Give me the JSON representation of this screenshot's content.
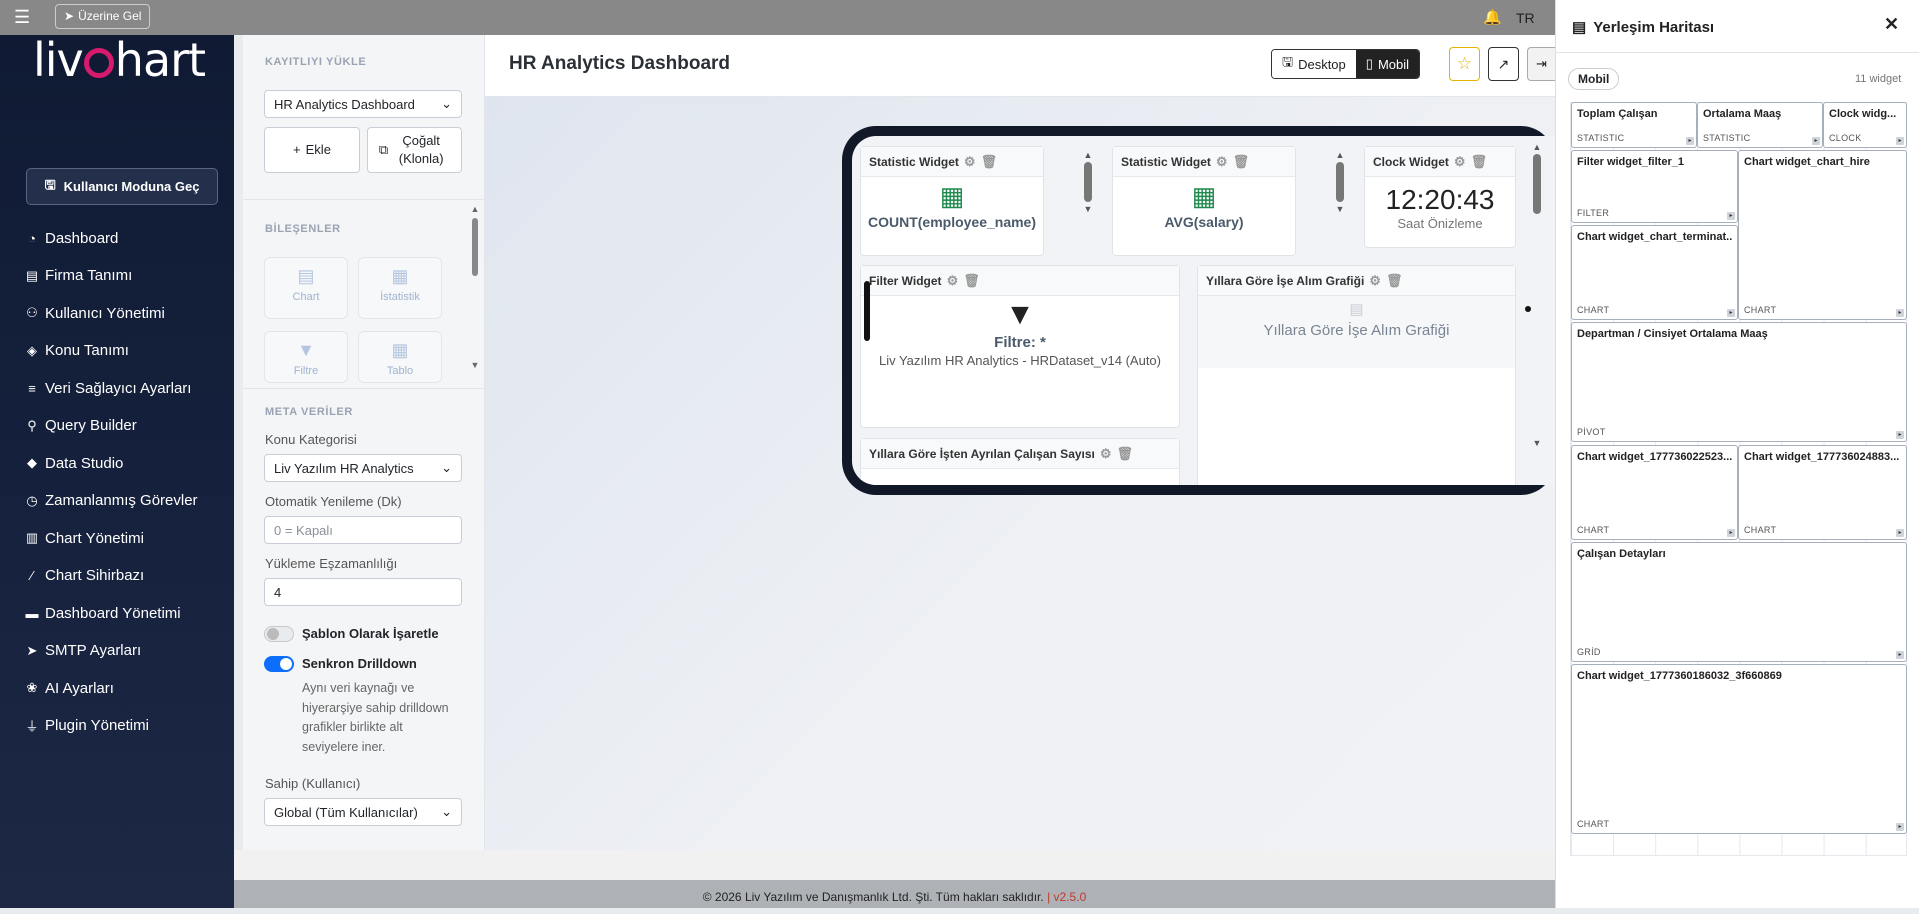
{
  "topbar": {
    "hover_label": "Üzerine Gel",
    "lang": "TR"
  },
  "brand": {
    "logo_left": "liv",
    "logo_right": "hart"
  },
  "nav": {
    "user_mode_button": "Kullanıcı Moduna Geç",
    "items": [
      {
        "label": "Dashboard",
        "icon": "gauge-icon"
      },
      {
        "label": "Firma Tanımı",
        "icon": "building-icon"
      },
      {
        "label": "Kullanıcı Yönetimi",
        "icon": "users-icon"
      },
      {
        "label": "Konu Tanımı",
        "icon": "tag-icon"
      },
      {
        "label": "Veri Sağlayıcı Ayarları",
        "icon": "server-icon"
      },
      {
        "label": "Query Builder",
        "icon": "search-icon"
      },
      {
        "label": "Data Studio",
        "icon": "layers-icon"
      },
      {
        "label": "Zamanlanmış Görevler",
        "icon": "clock-icon"
      },
      {
        "label": "Chart Yönetimi",
        "icon": "chart-icon"
      },
      {
        "label": "Chart Sihirbazı",
        "icon": "wand-icon"
      },
      {
        "label": "Dashboard Yönetimi",
        "icon": "card-icon"
      },
      {
        "label": "SMTP Ayarları",
        "icon": "send-icon"
      },
      {
        "label": "AI Ayarları",
        "icon": "brain-icon"
      },
      {
        "label": "Plugin Yönetimi",
        "icon": "plug-icon"
      }
    ]
  },
  "left_panel": {
    "load_title": "KAYITLIYI YÜKLE",
    "dashboard_select": "HR Analytics Dashboard",
    "add_button": "Ekle",
    "clone_button": "Çoğalt (Klonla)",
    "components_title": "BİLEŞENLER",
    "components": [
      {
        "label": "Chart",
        "icon": "chart-icon"
      },
      {
        "label": "İstatistik",
        "icon": "calculator-icon"
      },
      {
        "label": "Filtre",
        "icon": "filter-icon"
      },
      {
        "label": "Tablo",
        "icon": "table-icon"
      }
    ],
    "meta_title": "META VERİLER",
    "category_label": "Konu Kategorisi",
    "category_value": "Liv Yazılım HR Analytics",
    "refresh_label": "Otomatik Yenileme (Dk)",
    "refresh_placeholder": "0 = Kapalı",
    "concurrency_label": "Yükleme Eşzamanlılığı",
    "concurrency_value": "4",
    "template_toggle_label": "Şablon Olarak İşaretle",
    "template_toggle_on": false,
    "sync_toggle_label": "Senkron Drilldown",
    "sync_toggle_on": true,
    "sync_desc": "Aynı veri kaynağı ve hiyerarşiye sahip drilldown grafikler birlikte alt seviyelere iner.",
    "owner_label": "Sahip (Kullanıcı)",
    "owner_value": "Global (Tüm Kullanıcılar)"
  },
  "header": {
    "title": "HR Analytics Dashboard",
    "view_desktop": "Desktop",
    "view_mobile": "Mobil",
    "active_view": "Mobil"
  },
  "preview": {
    "stat1": {
      "title": "Statistic Widget",
      "value": "COUNT(employee_name)"
    },
    "stat2": {
      "title": "Statistic Widget",
      "value": "AVG(salary)"
    },
    "clock": {
      "title": "Clock Widget",
      "time": "12:20:43",
      "caption": "Saat Önizleme"
    },
    "filter": {
      "title": "Filter Widget",
      "text": "Filtre: *",
      "source": "Liv Yazılım HR Analytics - HRDataset_v14 (Auto)"
    },
    "hire_chart": {
      "title": "Yıllara Göre İşe Alım Grafiği",
      "body": "Yıllara Göre İşe Alım Grafiği"
    },
    "term_chart": {
      "title": "Yıllara Göre İşten Ayrılan Çalışan Sayısı"
    }
  },
  "footer": {
    "text": "© 2026 Liv Yazılım ve Danışmanlık Ltd. Şti. Tüm hakları saklıdır.",
    "sep": "|",
    "version": "v2.5.0"
  },
  "layout_map": {
    "title": "Yerleşim Haritası",
    "mode": "Mobil",
    "count": "11 widget",
    "cells": [
      {
        "title": "Toplam Çalışan",
        "kind": "STATISTIC"
      },
      {
        "title": "Ortalama Maaş",
        "kind": "STATISTIC"
      },
      {
        "title": "Clock widg...",
        "kind": "CLOCK"
      },
      {
        "title": "Filter widget_filter_1",
        "kind": "FILTER"
      },
      {
        "title": "Chart widget_chart_hire",
        "kind": "CHART"
      },
      {
        "title": "Chart widget_chart_terminat...",
        "kind": "CHART"
      },
      {
        "title": "Departman / Cinsiyet Ortalama Maaş",
        "kind": "PİVOT"
      },
      {
        "title": "Chart widget_177736022523...",
        "kind": "CHART"
      },
      {
        "title": "Chart widget_177736024883...",
        "kind": "CHART"
      },
      {
        "title": "Çalışan Detayları",
        "kind": "GRİD"
      },
      {
        "title": "Chart widget_1777360186032_3f660869",
        "kind": "CHART"
      }
    ]
  }
}
